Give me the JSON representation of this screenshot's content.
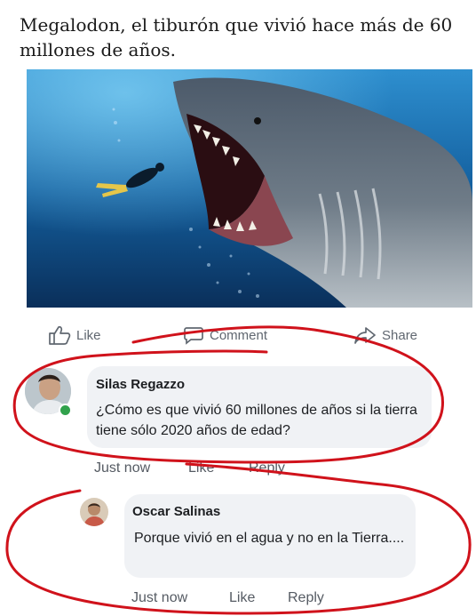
{
  "post": {
    "caption": "Megalodon, el tiburón que vivió hace más de 60 millones de años."
  },
  "actions": {
    "like_label": "Like",
    "comment_label": "Comment",
    "share_label": "Share"
  },
  "comments": [
    {
      "author": "Silas Regazzo",
      "text": "¿Cómo es que vivió 60 millones de años si la tierra tiene sólo 2020 años de edad?",
      "time": "Just now",
      "like_label": "Like",
      "reply_label": "Reply"
    },
    {
      "author": "Oscar Salinas",
      "text": "Porque vivió en el agua y no en la Tierra....",
      "time": "Just now",
      "like_label": "Like",
      "reply_label": "Reply"
    }
  ],
  "colors": {
    "annotation_red": "#d0121b",
    "online_green": "#31a24c",
    "comment_bubble": "#f0f2f5"
  },
  "icons": [
    "thumbs-up-icon",
    "comment-icon",
    "share-icon"
  ]
}
